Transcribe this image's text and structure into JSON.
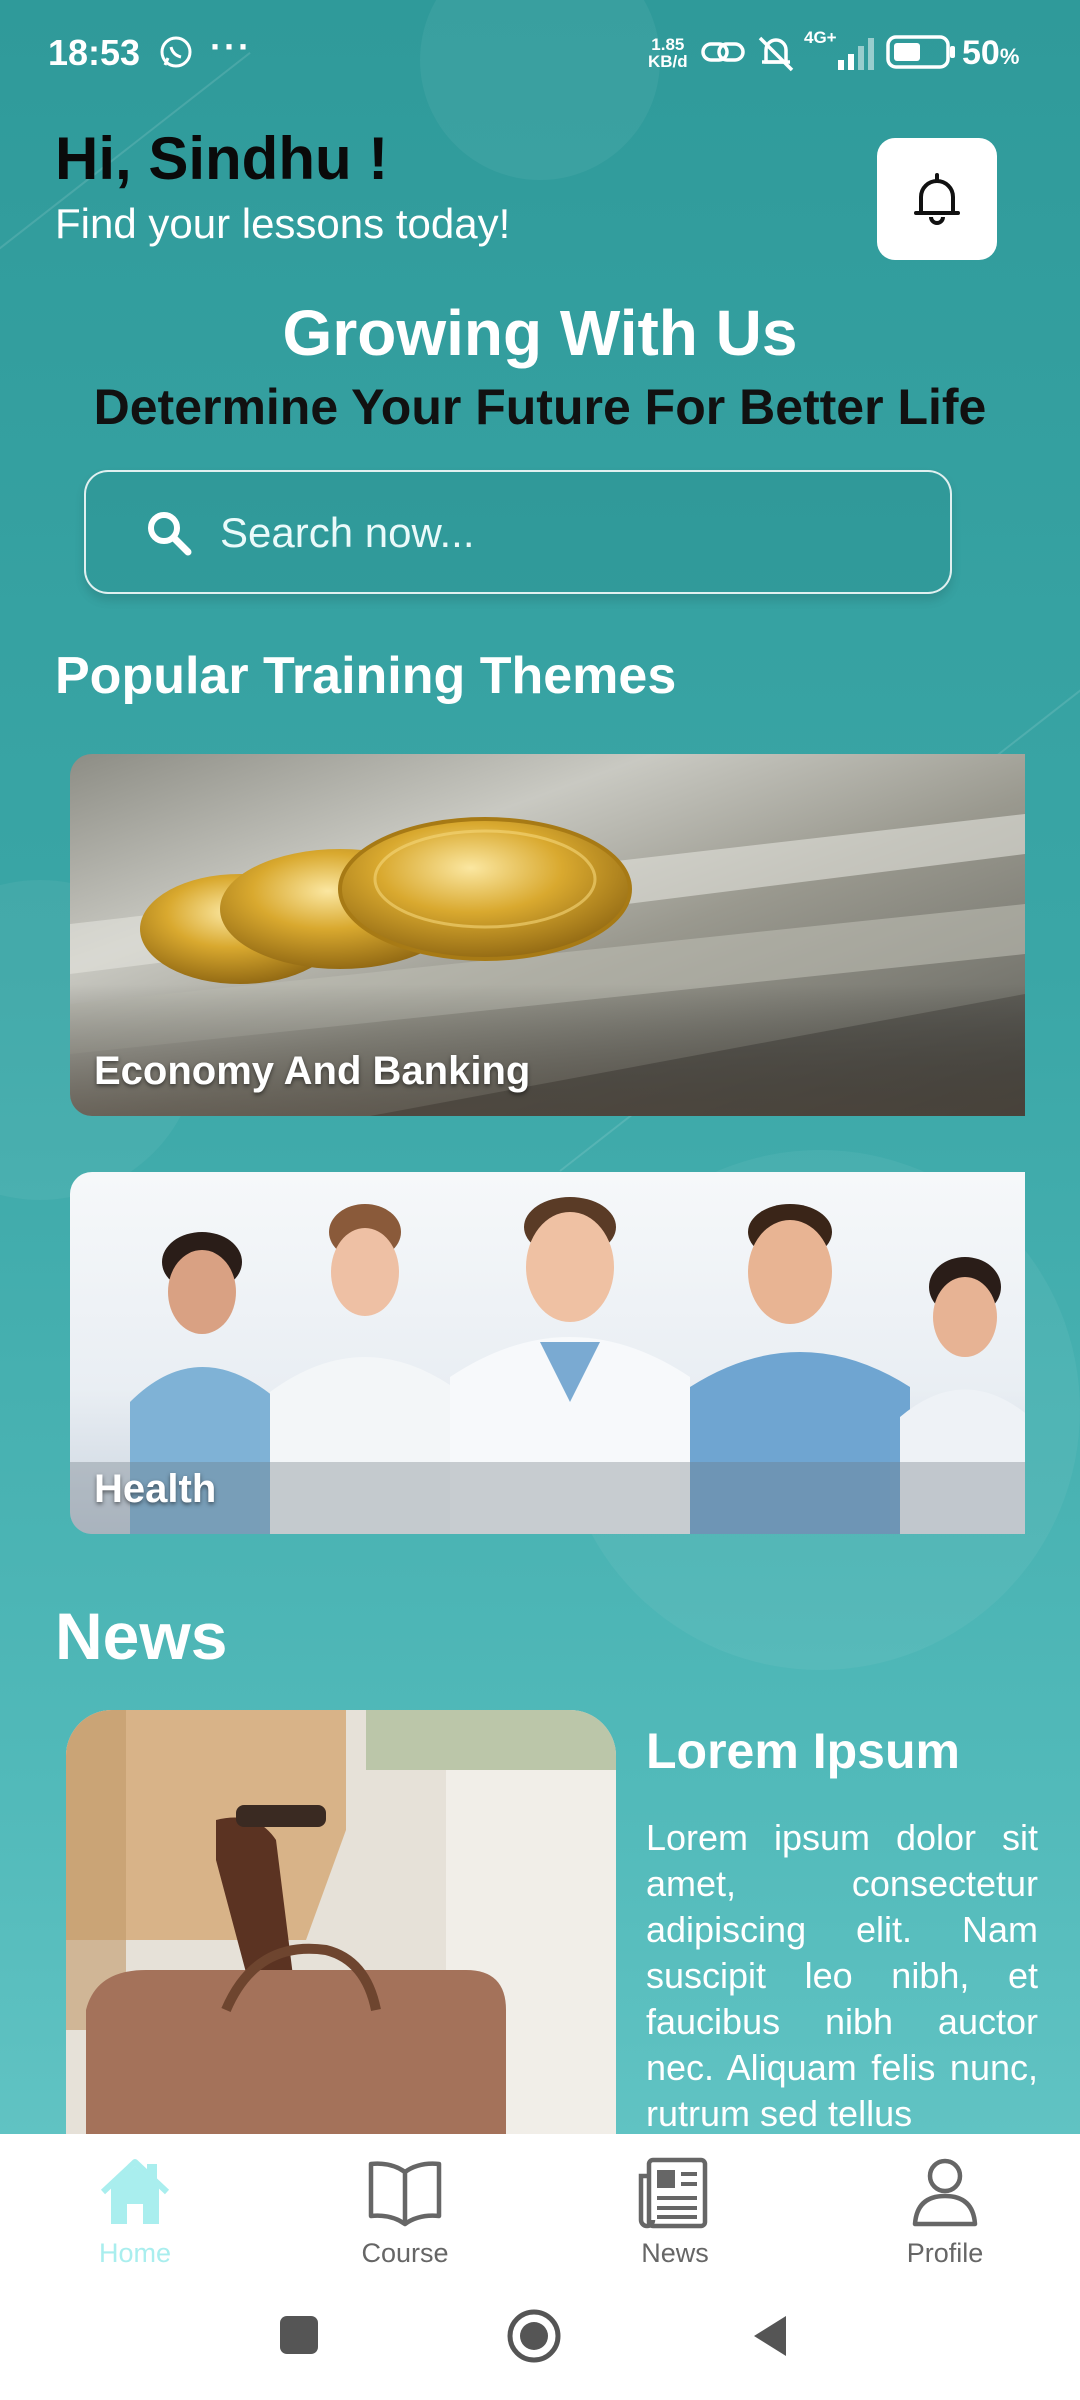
{
  "status_bar": {
    "time": "18:53",
    "net_speed_value": "1.85",
    "net_speed_unit": "KB/d",
    "signal_label": "4G+",
    "battery": "50",
    "battery_unit": "%"
  },
  "header": {
    "greeting": "Hi, Sindhu !",
    "subtitle": "Find your lessons today!"
  },
  "hero": {
    "title": "Growing With Us",
    "subtitle": "Determine Your Future For Better Life"
  },
  "search": {
    "placeholder": "Search now..."
  },
  "themes": {
    "title": "Popular Training Themes",
    "items": [
      {
        "label": "Economy And Banking"
      },
      {
        "label": "Health"
      }
    ]
  },
  "news": {
    "title": "News",
    "article": {
      "title": "Lorem Ipsum",
      "body": "Lorem ipsum dolor sit amet, consectetur adipiscing elit. Nam suscipit leo nibh, et faucibus nibh auctor nec. Aliquam felis nunc, rutrum sed tellus"
    }
  },
  "bottom_nav": {
    "items": [
      {
        "label": "Home",
        "icon": "home-icon",
        "active": true
      },
      {
        "label": "Course",
        "icon": "book-icon",
        "active": false
      },
      {
        "label": "News",
        "icon": "newspaper-icon",
        "active": false
      },
      {
        "label": "Profile",
        "icon": "profile-icon",
        "active": false
      }
    ]
  },
  "colors": {
    "background_top": "#2f9a9a",
    "background_bottom": "#6ccaca",
    "nav_active": "#a9eeee",
    "nav_inactive": "#666666"
  }
}
